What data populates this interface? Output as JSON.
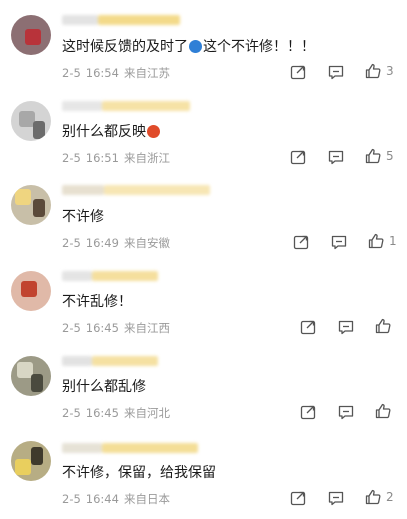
{
  "comments": [
    {
      "text_before": "这时候反馈的及时了",
      "has_emoji": true,
      "emoji_color": "#2f7fd6",
      "text_after": "这个不许修！！！",
      "date": "2-5",
      "time": "16:54",
      "location": "来自江苏",
      "likes": "3"
    },
    {
      "text_before": "别什么都反映",
      "has_emoji": true,
      "emoji_color": "#e04b2a",
      "text_after": "",
      "date": "2-5",
      "time": "16:51",
      "location": "来自浙江",
      "likes": "5"
    },
    {
      "text_before": "不许修",
      "has_emoji": false,
      "text_after": "",
      "date": "2-5",
      "time": "16:49",
      "location": "来自安徽",
      "likes": "1"
    },
    {
      "text_before": "不许乱修！",
      "has_emoji": false,
      "text_after": "",
      "date": "2-5",
      "time": "16:45",
      "location": "来自江西",
      "likes": ""
    },
    {
      "text_before": "别什么都乱修",
      "has_emoji": false,
      "text_after": "",
      "date": "2-5",
      "time": "16:45",
      "location": "来自河北",
      "likes": ""
    },
    {
      "text_before": "不许修，保留，给我保留",
      "has_emoji": false,
      "text_after": "",
      "date": "2-5",
      "time": "16:44",
      "location": "来自日本",
      "likes": "2"
    }
  ],
  "icons": {
    "share": "share-icon",
    "reply": "comment-icon",
    "like": "thumbs-up-icon"
  },
  "colors": {
    "text": "#1a1a1a",
    "meta": "#9a9a9a",
    "icon": "#555555",
    "name_blur": "#f2d889"
  }
}
